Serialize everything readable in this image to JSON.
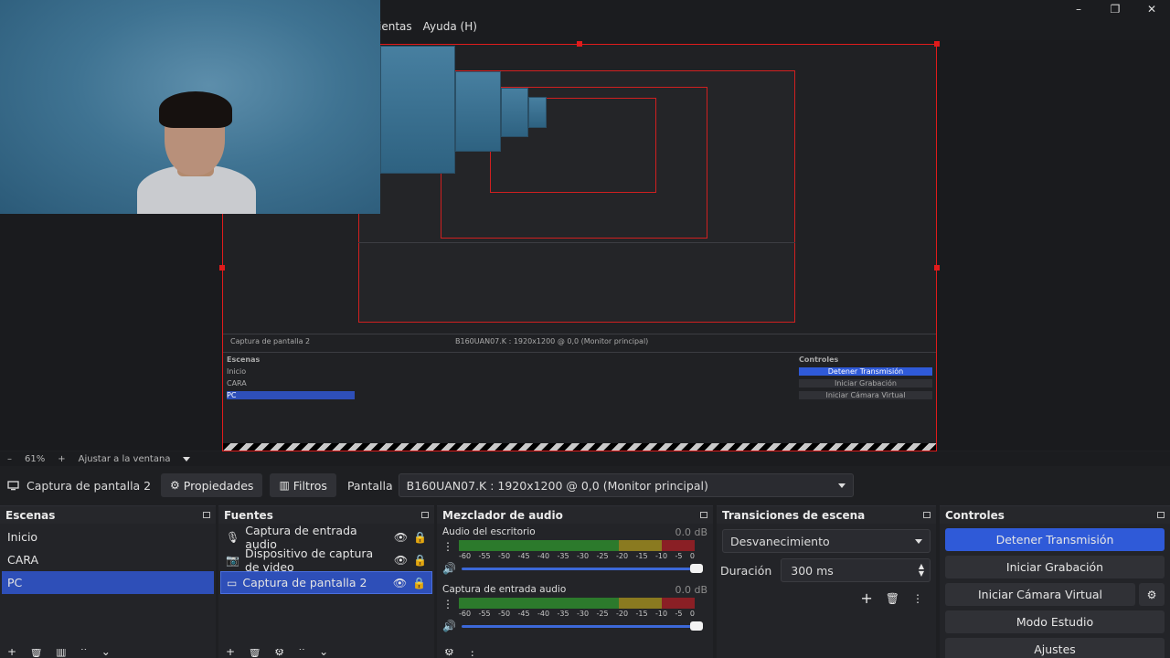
{
  "menu": {
    "items": [
      "ientas",
      "Ayuda (H)"
    ]
  },
  "window": {
    "minimize": "–",
    "maximize": "❐",
    "close": "✕"
  },
  "zoom": {
    "minus": "–",
    "value": "61%",
    "plus": "+",
    "fit": "Ajustar a la ventana"
  },
  "source_toolbar": {
    "source_name": "Captura de pantalla 2",
    "properties": "Propiedades",
    "filters": "Filtros",
    "display_label": "Pantalla",
    "display_value": "B160UAN07.K : 1920x1200 @ 0,0 (Monitor principal)"
  },
  "scenes": {
    "title": "Escenas",
    "items": [
      "Inicio",
      "CARA",
      "PC"
    ],
    "selected": "PC"
  },
  "sources": {
    "title": "Fuentes",
    "items": [
      {
        "label": "Captura de entrada audio",
        "icon": "microphone-icon"
      },
      {
        "label": "Dispositivo de captura de video",
        "icon": "camera-icon"
      },
      {
        "label": "Captura de pantalla 2",
        "icon": "monitor-icon"
      }
    ],
    "selected": "Captura de pantalla 2"
  },
  "mixer": {
    "title": "Mezclador de audio",
    "ticks": [
      "-60",
      "-55",
      "-50",
      "-45",
      "-40",
      "-35",
      "-30",
      "-25",
      "-20",
      "-15",
      "-10",
      "-5",
      "0"
    ],
    "channels": [
      {
        "name": "Audio del escritorio",
        "db": "0.0 dB",
        "volume": 1.0
      },
      {
        "name": "Captura de entrada audio",
        "db": "0.0 dB",
        "volume": 1.0
      }
    ]
  },
  "transitions": {
    "title": "Transiciones de escena",
    "selected": "Desvanecimiento",
    "duration_label": "Duración",
    "duration_value": "300 ms"
  },
  "controls": {
    "title": "Controles",
    "stop_stream": "Detener Transmisión",
    "start_recording": "Iniciar Grabación",
    "virtual_camera": "Iniciar Cámara Virtual",
    "studio_mode": "Modo Estudio",
    "settings": "Ajustes"
  },
  "colors": {
    "accent": "#2f5ad8",
    "selection": "#2e4fb8",
    "bounding_box": "#e01b1b"
  }
}
